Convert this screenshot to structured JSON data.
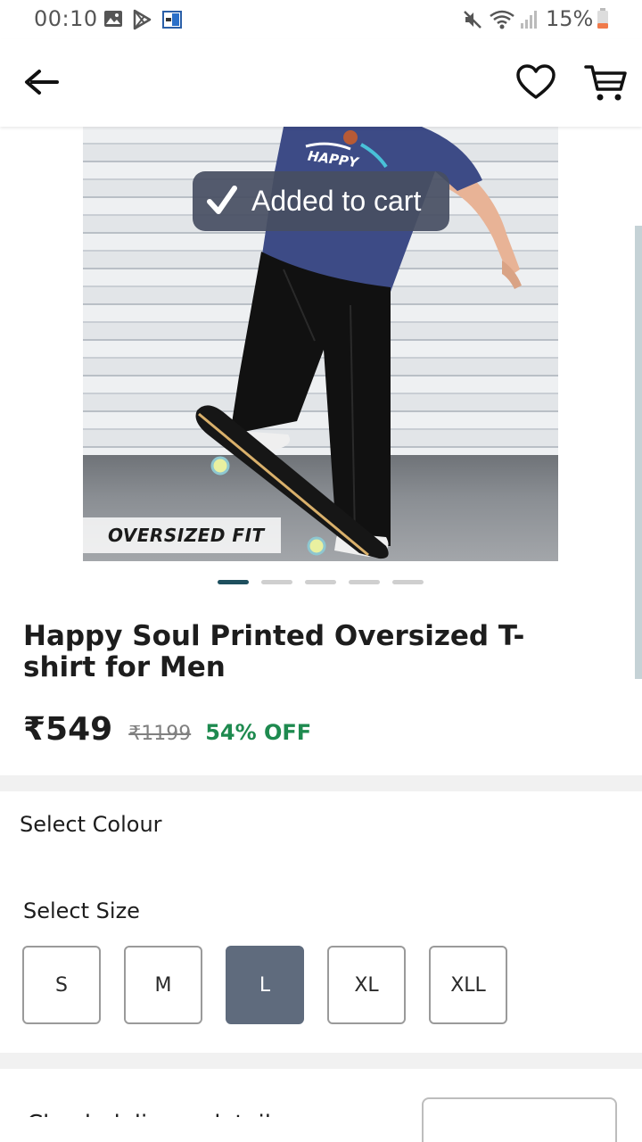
{
  "status_bar": {
    "time": "00:10",
    "battery": "15%"
  },
  "header": {
    "back_icon": "arrow-left-icon",
    "wishlist_icon": "heart-outline-icon",
    "cart_icon": "cart-icon"
  },
  "product": {
    "image_badge": "OVERSIZED FIT",
    "shirt_print": "HAPPY",
    "title": "Happy Soul Printed Oversized T-shirt for Men",
    "price": "₹549",
    "mrp": "₹1199",
    "discount": "54% OFF",
    "image_count": 5,
    "active_image": 1
  },
  "toast": {
    "text": "Added to cart",
    "icon": "checkmark-icon"
  },
  "colour": {
    "label": "Select Colour"
  },
  "size": {
    "label": "Select Size",
    "options": [
      "S",
      "M",
      "L",
      "XL",
      "XLL"
    ],
    "selected": "L"
  },
  "delivery": {
    "label": "Check delivery details"
  },
  "colors": {
    "accent": "#1e4f5e",
    "discount_green": "#1e8a4f",
    "selected_size": "#5f6b7d",
    "toast_bg": "#464e62"
  }
}
